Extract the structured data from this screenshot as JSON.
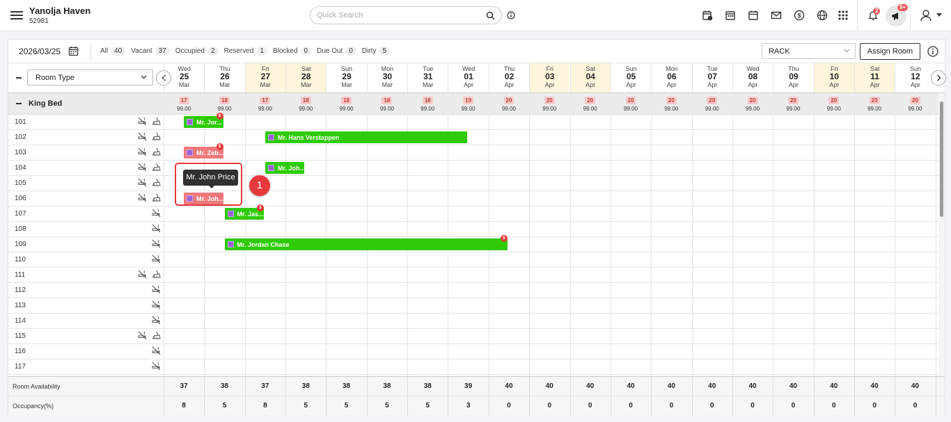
{
  "header": {
    "hotel_name": "Yanolja Haven",
    "hotel_code": "52981",
    "search_placeholder": "Quick Search",
    "notifications_count": "2",
    "announcements_count": "9+"
  },
  "toolbar": {
    "date": "2026/03/25",
    "filters": [
      {
        "label": "All",
        "count": "40"
      },
      {
        "label": "Vacant",
        "count": "37"
      },
      {
        "label": "Occupied",
        "count": "2"
      },
      {
        "label": "Reserved",
        "count": "1"
      },
      {
        "label": "Blocked",
        "count": "0"
      },
      {
        "label": "Due Out",
        "count": "0"
      },
      {
        "label": "Dirty",
        "count": "5"
      }
    ],
    "rate_plan": "RACK",
    "assign_room_label": "Assign Room"
  },
  "room_type_select": "Room Type",
  "dates": [
    {
      "dow": "Wed",
      "day": "25",
      "month": "Mar",
      "weekend": false
    },
    {
      "dow": "Thu",
      "day": "26",
      "month": "Mar",
      "weekend": false
    },
    {
      "dow": "Fri",
      "day": "27",
      "month": "Mar",
      "weekend": true
    },
    {
      "dow": "Sat",
      "day": "28",
      "month": "Mar",
      "weekend": true
    },
    {
      "dow": "Sun",
      "day": "29",
      "month": "Mar",
      "weekend": false
    },
    {
      "dow": "Mon",
      "day": "30",
      "month": "Mar",
      "weekend": false
    },
    {
      "dow": "Tue",
      "day": "31",
      "month": "Mar",
      "weekend": false
    },
    {
      "dow": "Wed",
      "day": "01",
      "month": "Apr",
      "weekend": false
    },
    {
      "dow": "Thu",
      "day": "02",
      "month": "Apr",
      "weekend": false
    },
    {
      "dow": "Fri",
      "day": "03",
      "month": "Apr",
      "weekend": true
    },
    {
      "dow": "Sat",
      "day": "04",
      "month": "Apr",
      "weekend": true
    },
    {
      "dow": "Sun",
      "day": "05",
      "month": "Apr",
      "weekend": false
    },
    {
      "dow": "Mon",
      "day": "06",
      "month": "Apr",
      "weekend": false
    },
    {
      "dow": "Tue",
      "day": "07",
      "month": "Apr",
      "weekend": false
    },
    {
      "dow": "Wed",
      "day": "08",
      "month": "Apr",
      "weekend": false
    },
    {
      "dow": "Thu",
      "day": "09",
      "month": "Apr",
      "weekend": false
    },
    {
      "dow": "Fri",
      "day": "10",
      "month": "Apr",
      "weekend": true
    },
    {
      "dow": "Sat",
      "day": "11",
      "month": "Apr",
      "weekend": true
    },
    {
      "dow": "Sun",
      "day": "12",
      "month": "Apr",
      "weekend": false
    }
  ],
  "group": {
    "name": "King Bed",
    "availability": [
      "17",
      "18",
      "17",
      "18",
      "18",
      "18",
      "18",
      "19",
      "20",
      "20",
      "20",
      "20",
      "20",
      "20",
      "20",
      "20",
      "20",
      "20",
      "20"
    ],
    "price": "99.00"
  },
  "rooms": [
    {
      "number": "101",
      "smoking": true
    },
    {
      "number": "102",
      "smoking": true
    },
    {
      "number": "103",
      "smoking": true
    },
    {
      "number": "104",
      "smoking": true
    },
    {
      "number": "105",
      "smoking": true
    },
    {
      "number": "106",
      "smoking": true
    },
    {
      "number": "107",
      "smoking": false
    },
    {
      "number": "108",
      "smoking": false
    },
    {
      "number": "109",
      "smoking": false
    },
    {
      "number": "110",
      "smoking": false
    },
    {
      "number": "111",
      "smoking": true
    },
    {
      "number": "112",
      "smoking": false
    },
    {
      "number": "113",
      "smoking": false
    },
    {
      "number": "114",
      "smoking": false
    },
    {
      "number": "115",
      "smoking": true
    },
    {
      "number": "116",
      "smoking": false
    },
    {
      "number": "117",
      "smoking": false
    }
  ],
  "bookings": [
    {
      "room_index": 0,
      "start_day": 0.5,
      "nights": 1,
      "guest": "Mr. Jor...",
      "status": "green",
      "paid_badge": true
    },
    {
      "room_index": 1,
      "start_day": 2.5,
      "nights": 5,
      "guest": "Mr. Hans Verstappen",
      "status": "green",
      "paid_badge": false
    },
    {
      "room_index": 2,
      "start_day": 0.5,
      "nights": 1,
      "guest": "Mr. Zeb...",
      "status": "red",
      "paid_badge": true
    },
    {
      "room_index": 3,
      "start_day": 2.5,
      "nights": 1,
      "guest": "Mr. Joh...",
      "status": "green",
      "paid_badge": false
    },
    {
      "room_index": 5,
      "start_day": 0.5,
      "nights": 1,
      "guest": "Mr. Joh...",
      "status": "red",
      "paid_badge": false
    },
    {
      "room_index": 6,
      "start_day": 1.5,
      "nights": 1,
      "guest": "Mr. Jas...",
      "status": "green",
      "paid_badge": true
    },
    {
      "room_index": 8,
      "start_day": 1.5,
      "nights": 7,
      "guest": "Mr. Jordan Chase",
      "status": "green",
      "paid_badge": true
    }
  ],
  "paid_badge_symbol": "$",
  "tooltip": {
    "text": "Mr. John Price"
  },
  "step_marker": "1",
  "footer": {
    "availability_label": "Room Availability",
    "availability": [
      "37",
      "38",
      "37",
      "38",
      "38",
      "38",
      "38",
      "39",
      "40",
      "40",
      "40",
      "40",
      "40",
      "40",
      "40",
      "40",
      "40",
      "40",
      "40"
    ],
    "occupancy_label": "Occupancy(%)",
    "occupancy": [
      "8",
      "5",
      "8",
      "5",
      "5",
      "5",
      "5",
      "3",
      "0",
      "0",
      "0",
      "0",
      "0",
      "0",
      "0",
      "0",
      "0",
      "0",
      "0"
    ]
  },
  "colors": {
    "booking_confirmed": "#2fcb08",
    "booking_checkout": "#f0797c",
    "weekend_bg": "#fdf6dc",
    "accent_red": "#e5393c"
  }
}
